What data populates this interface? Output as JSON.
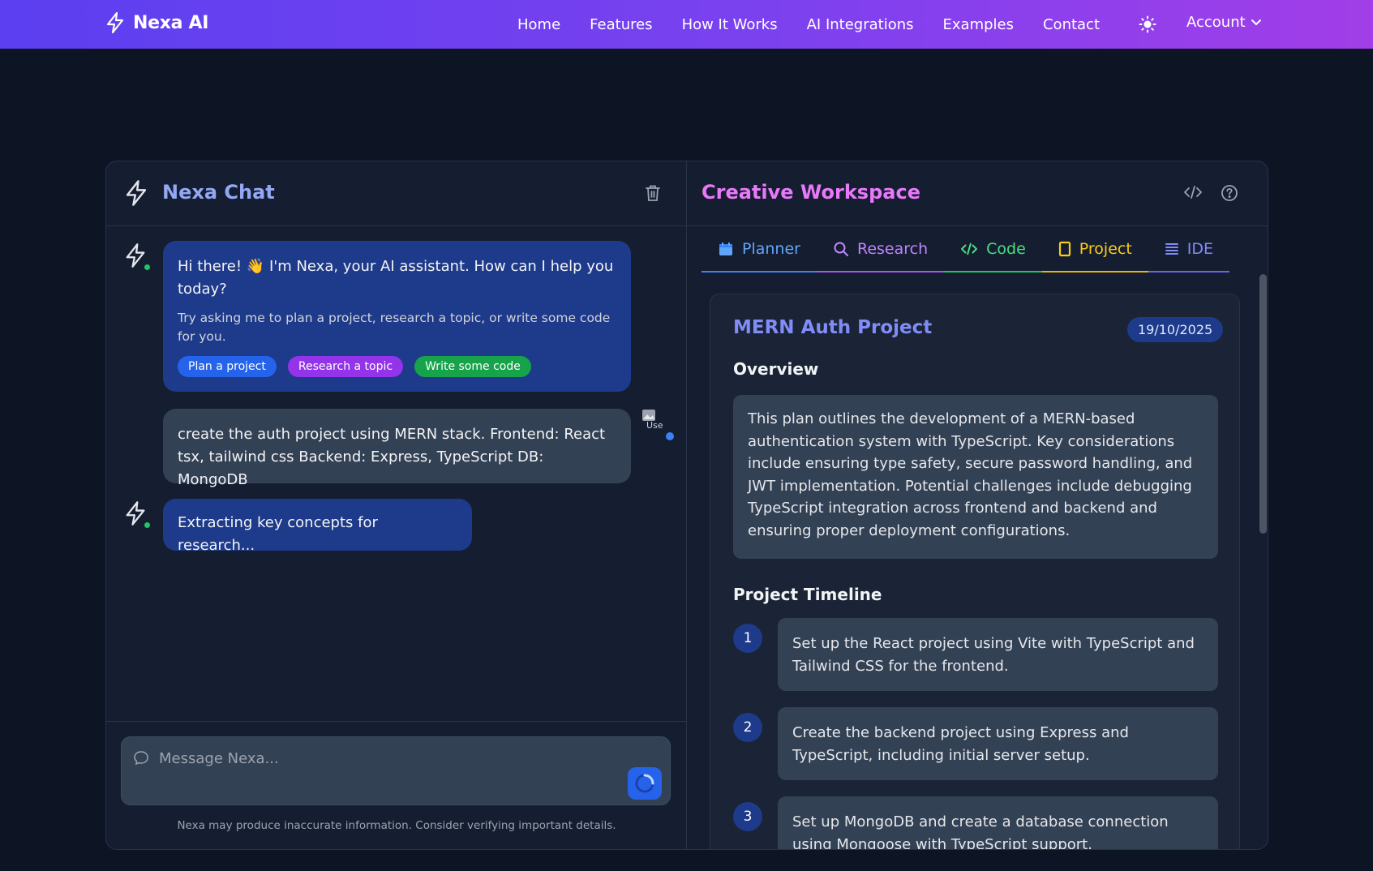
{
  "nav": {
    "brand": "Nexa AI",
    "links": [
      "Home",
      "Features",
      "How It Works",
      "AI Integrations",
      "Examples",
      "Contact"
    ],
    "account_label": "Account",
    "theme_icon": "sun-icon"
  },
  "chat": {
    "title": "Nexa Chat",
    "messages": {
      "greeting_primary": "Hi there! 👋 I'm Nexa, your AI assistant. How can I help you today?",
      "greeting_secondary": "Try asking me to plan a project, research a topic, or write some code for you.",
      "suggestions": [
        "Plan a project",
        "Research a topic",
        "Write some code"
      ],
      "user_message": "create the auth project using MERN stack. Frontend: React tsx, tailwind css Backend: Express, TypeScript DB: MongoDB",
      "user_avatar_alt": "Use",
      "status_message": "Extracting key concepts for research..."
    },
    "input_placeholder": "Message Nexa...",
    "disclaimer": "Nexa may produce inaccurate information. Consider verifying important details."
  },
  "workspace": {
    "title": "Creative Workspace",
    "tabs": [
      {
        "label": "Planner",
        "color": "#60a5fa",
        "underline": "#3b82f6"
      },
      {
        "label": "Research",
        "color": "#c084fc",
        "underline": "#a855f7"
      },
      {
        "label": "Code",
        "color": "#4ade80",
        "underline": "#22c55e"
      },
      {
        "label": "Project",
        "color": "#facc15",
        "underline": "#eab308"
      },
      {
        "label": "IDE",
        "color": "#818cf8",
        "underline": "#6366f1"
      }
    ],
    "project": {
      "title": "MERN Auth Project",
      "date": "19/10/2025",
      "overview_heading": "Overview",
      "overview": "This plan outlines the development of a MERN-based authentication system with TypeScript. Key considerations include ensuring type safety, secure password handling, and JWT implementation. Potential challenges include debugging TypeScript integration across frontend and backend and ensuring proper deployment configurations.",
      "timeline_heading": "Project Timeline",
      "steps": [
        {
          "num": "1",
          "text": "Set up the React project using Vite with TypeScript and Tailwind CSS for the frontend."
        },
        {
          "num": "2",
          "text": "Create the backend project using Express and TypeScript, including initial server setup."
        },
        {
          "num": "3",
          "text": "Set up MongoDB and create a database connection using Mongoose with TypeScript support."
        }
      ]
    }
  }
}
